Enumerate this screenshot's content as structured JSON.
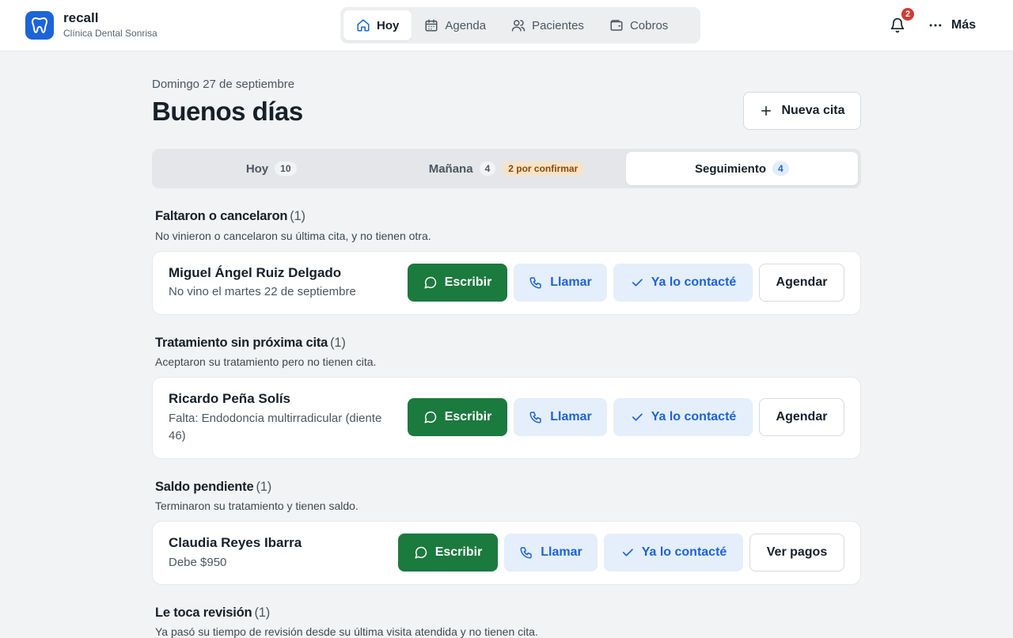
{
  "app": {
    "name": "recall",
    "clinic": "Clínica Dental Sonrisa"
  },
  "nav": {
    "items": [
      {
        "label": "Hoy",
        "icon": "home-icon",
        "active": true
      },
      {
        "label": "Agenda",
        "icon": "calendar-icon",
        "active": false
      },
      {
        "label": "Pacientes",
        "icon": "users-icon",
        "active": false
      },
      {
        "label": "Cobros",
        "icon": "wallet-icon",
        "active": false
      }
    ],
    "notifications_count": "2",
    "more_label": "Más"
  },
  "header": {
    "date": "Domingo 27 de septiembre",
    "greeting": "Buenos días",
    "new_appointment_label": "Nueva cita"
  },
  "tabs": [
    {
      "label": "Hoy",
      "count": "10"
    },
    {
      "label": "Mañana",
      "count": "4",
      "pill": "2 por confirmar"
    },
    {
      "label": "Seguimiento",
      "count": "4",
      "active": true
    }
  ],
  "sections": [
    {
      "title": "Faltaron o cancelaron",
      "count": "(1)",
      "subtitle": "No vinieron o cancelaron su última cita, y no tienen otra.",
      "patient": {
        "name": "Miguel Ángel Ruiz Delgado",
        "detail": "No vino el martes 22 de septiembre"
      },
      "actions": {
        "write": "Escribir",
        "call": "Llamar",
        "done": "Ya lo contacté",
        "secondary": "Agendar"
      }
    },
    {
      "title": "Tratamiento sin próxima cita",
      "count": "(1)",
      "subtitle": "Aceptaron su tratamiento pero no tienen cita.",
      "patient": {
        "name": "Ricardo Peña Solís",
        "detail": "Falta: Endodoncia multirradicular (diente 46)"
      },
      "actions": {
        "write": "Escribir",
        "call": "Llamar",
        "done": "Ya lo contacté",
        "secondary": "Agendar"
      }
    },
    {
      "title": "Saldo pendiente",
      "count": "(1)",
      "subtitle": "Terminaron su tratamiento y tienen saldo.",
      "patient": {
        "name": "Claudia Reyes Ibarra",
        "detail": "Debe $950"
      },
      "actions": {
        "write": "Escribir",
        "call": "Llamar",
        "done": "Ya lo contacté",
        "secondary": "Ver pagos"
      }
    },
    {
      "title": "Le toca revisión",
      "count": "(1)",
      "subtitle": "Ya pasó su tiempo de revisión desde su última visita atendida y no tienen cita."
    }
  ],
  "colors": {
    "brand": "#1d64d8",
    "write_button": "#1b7a3e",
    "badge_red": "#d13b34"
  }
}
